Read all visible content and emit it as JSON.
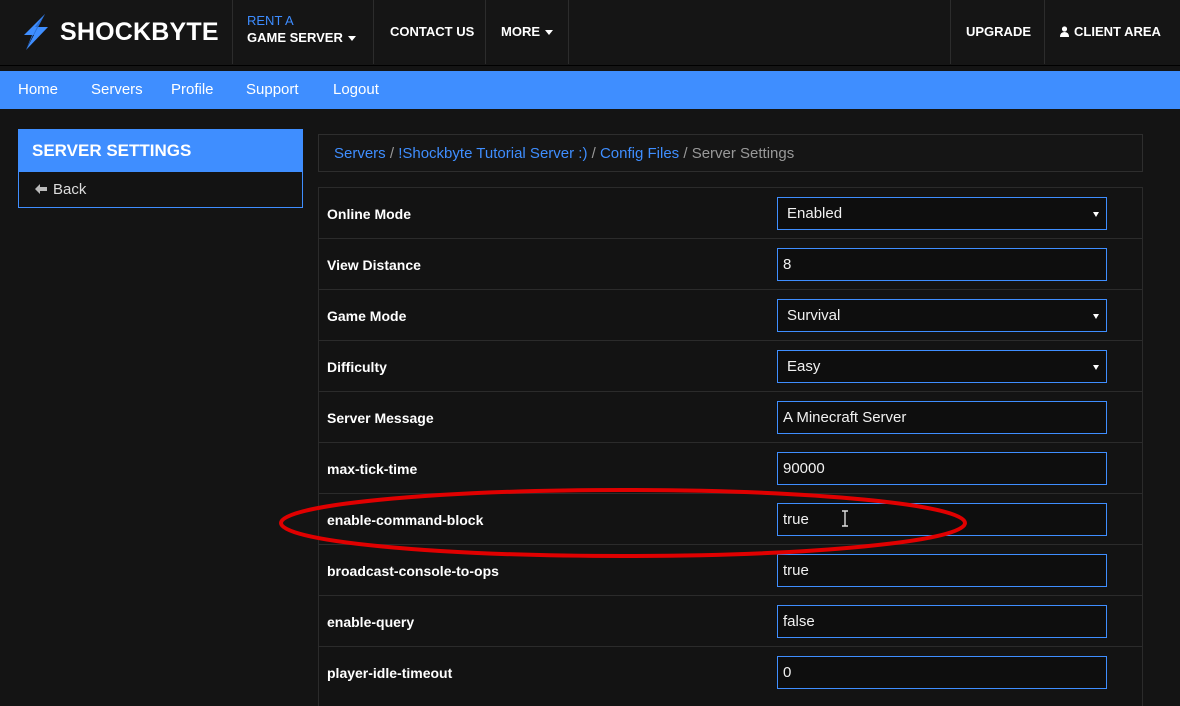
{
  "brand": {
    "name": "SHOCKBYTE"
  },
  "topnav": {
    "rent_small": "RENT A",
    "rent_big": "GAME SERVER",
    "contact": "CONTACT US",
    "more": "MORE",
    "upgrade": "UPGRADE",
    "client_area": "CLIENT AREA"
  },
  "subnav": {
    "items": [
      "Home",
      "Servers",
      "Profile",
      "Support",
      "Logout"
    ]
  },
  "sidebar": {
    "title": "SERVER SETTINGS",
    "back": "Back"
  },
  "breadcrumb": {
    "servers": "Servers",
    "server_name": "!Shockbyte Tutorial Server :)",
    "config_files": "Config Files",
    "current": "Server Settings",
    "separator": "/"
  },
  "settings": [
    {
      "label": "Online Mode",
      "value": "Enabled",
      "type": "select"
    },
    {
      "label": "View Distance",
      "value": "8",
      "type": "input"
    },
    {
      "label": "Game Mode",
      "value": "Survival",
      "type": "select"
    },
    {
      "label": "Difficulty",
      "value": "Easy",
      "type": "select"
    },
    {
      "label": "Server Message",
      "value": "A Minecraft Server",
      "type": "input"
    },
    {
      "label": "max-tick-time",
      "value": "90000",
      "type": "input"
    },
    {
      "label": "enable-command-block",
      "value": "true",
      "type": "input"
    },
    {
      "label": "broadcast-console-to-ops",
      "value": "true",
      "type": "input"
    },
    {
      "label": "enable-query",
      "value": "false",
      "type": "input"
    },
    {
      "label": "player-idle-timeout",
      "value": "0",
      "type": "input"
    }
  ],
  "icons": {
    "logo": "lightning-bolt-icon",
    "dropdown": "caret-down-icon",
    "user": "user-icon",
    "back": "arrow-left-icon",
    "cursor": "text-cursor-icon"
  },
  "colors": {
    "accent": "#3f8eff",
    "background": "#141414",
    "highlight": "#e00000"
  }
}
